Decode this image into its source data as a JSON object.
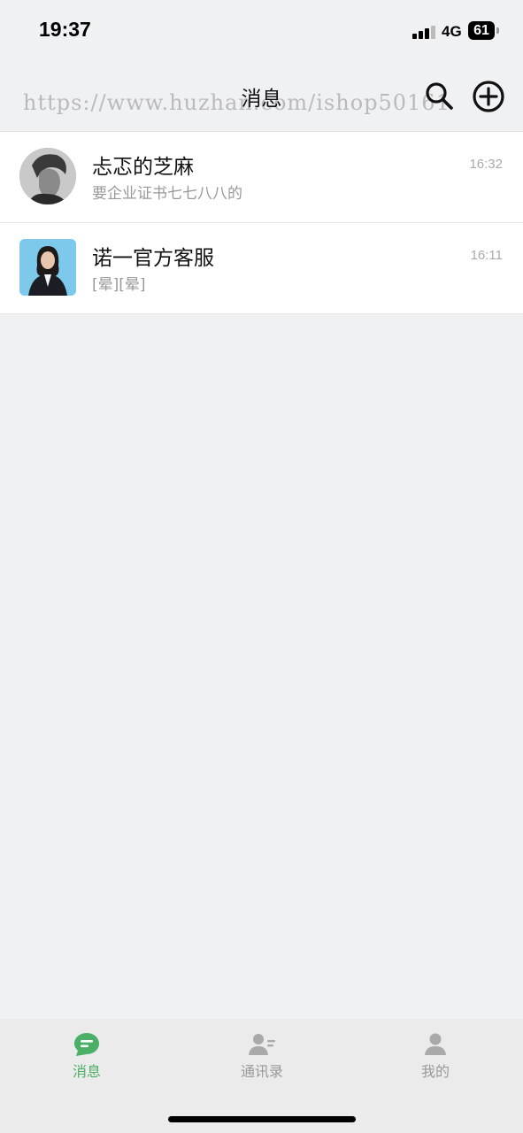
{
  "status_bar": {
    "time": "19:37",
    "network": "4G",
    "battery": "61"
  },
  "nav": {
    "title": "消息",
    "watermark": "https://www.huzhan.com/ishop50161",
    "icons": [
      "search-icon",
      "add-circle-icon"
    ]
  },
  "chats": [
    {
      "name": "忐忑的芝麻",
      "preview": "要企业证书七七八八的",
      "time": "16:32"
    },
    {
      "name": "诺一官方客服",
      "preview": "[晕][晕]",
      "time": "16:11"
    }
  ],
  "tab_bar": {
    "tabs": [
      {
        "label": "消息",
        "icon": "message-icon",
        "active": true
      },
      {
        "label": "通讯录",
        "icon": "contacts-icon",
        "active": false
      },
      {
        "label": "我的",
        "icon": "profile-icon",
        "active": false
      }
    ]
  },
  "colors": {
    "accent": "#4caf67",
    "background": "#f0f1f3"
  }
}
